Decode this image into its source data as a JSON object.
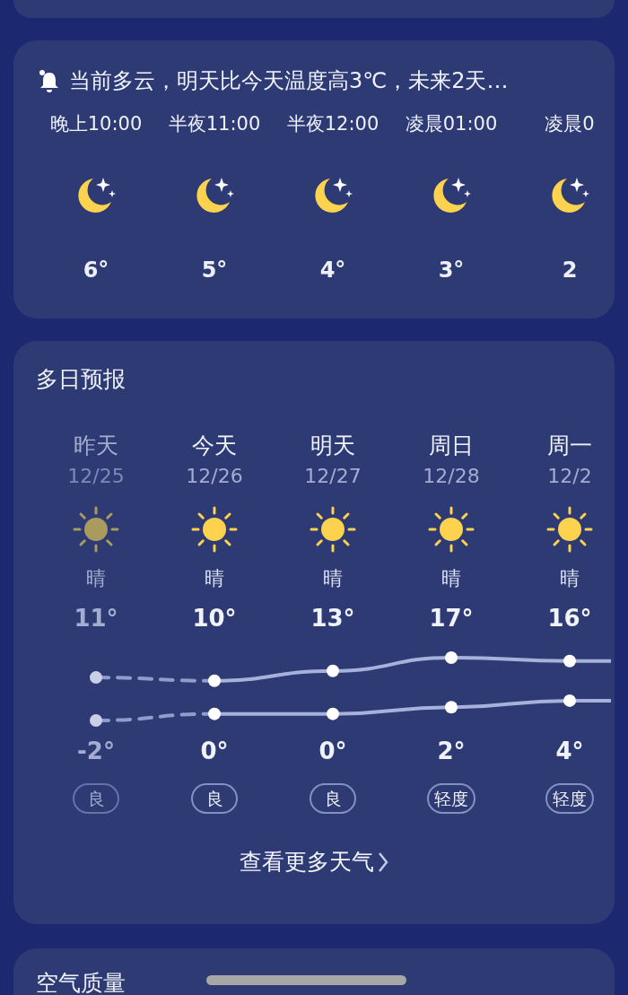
{
  "alert": {
    "text": "当前多云，明天比今天温度高3℃，未来2天…"
  },
  "hourly": [
    {
      "time": "晚上10:00",
      "kind": "moon",
      "temp": "6°"
    },
    {
      "time": "半夜11:00",
      "kind": "moon",
      "temp": "5°"
    },
    {
      "time": "半夜12:00",
      "kind": "moon",
      "temp": "4°"
    },
    {
      "time": "凌晨01:00",
      "kind": "moon",
      "temp": "3°"
    },
    {
      "time": "凌晨0",
      "kind": "moon",
      "temp": "2"
    }
  ],
  "forecast": {
    "title": "多日预报",
    "days": [
      {
        "day": "昨天",
        "date": "12/25",
        "kind": "sun",
        "weather": "晴",
        "high": "11°",
        "low": "-2°",
        "aqi": "良",
        "past": true
      },
      {
        "day": "今天",
        "date": "12/26",
        "kind": "sun",
        "weather": "晴",
        "high": "10°",
        "low": "0°",
        "aqi": "良",
        "past": false
      },
      {
        "day": "明天",
        "date": "12/27",
        "kind": "sun",
        "weather": "晴",
        "high": "13°",
        "low": "0°",
        "aqi": "良",
        "past": false
      },
      {
        "day": "周日",
        "date": "12/28",
        "kind": "sun",
        "weather": "晴",
        "high": "17°",
        "low": "2°",
        "aqi": "轻度",
        "past": false
      },
      {
        "day": "周一",
        "date": "12/2",
        "kind": "sun",
        "weather": "晴",
        "high": "16°",
        "low": "4°",
        "aqi": "轻度",
        "past": false
      }
    ],
    "more_button": "查看更多天气"
  },
  "air_quality": {
    "title": "空气质量"
  }
}
